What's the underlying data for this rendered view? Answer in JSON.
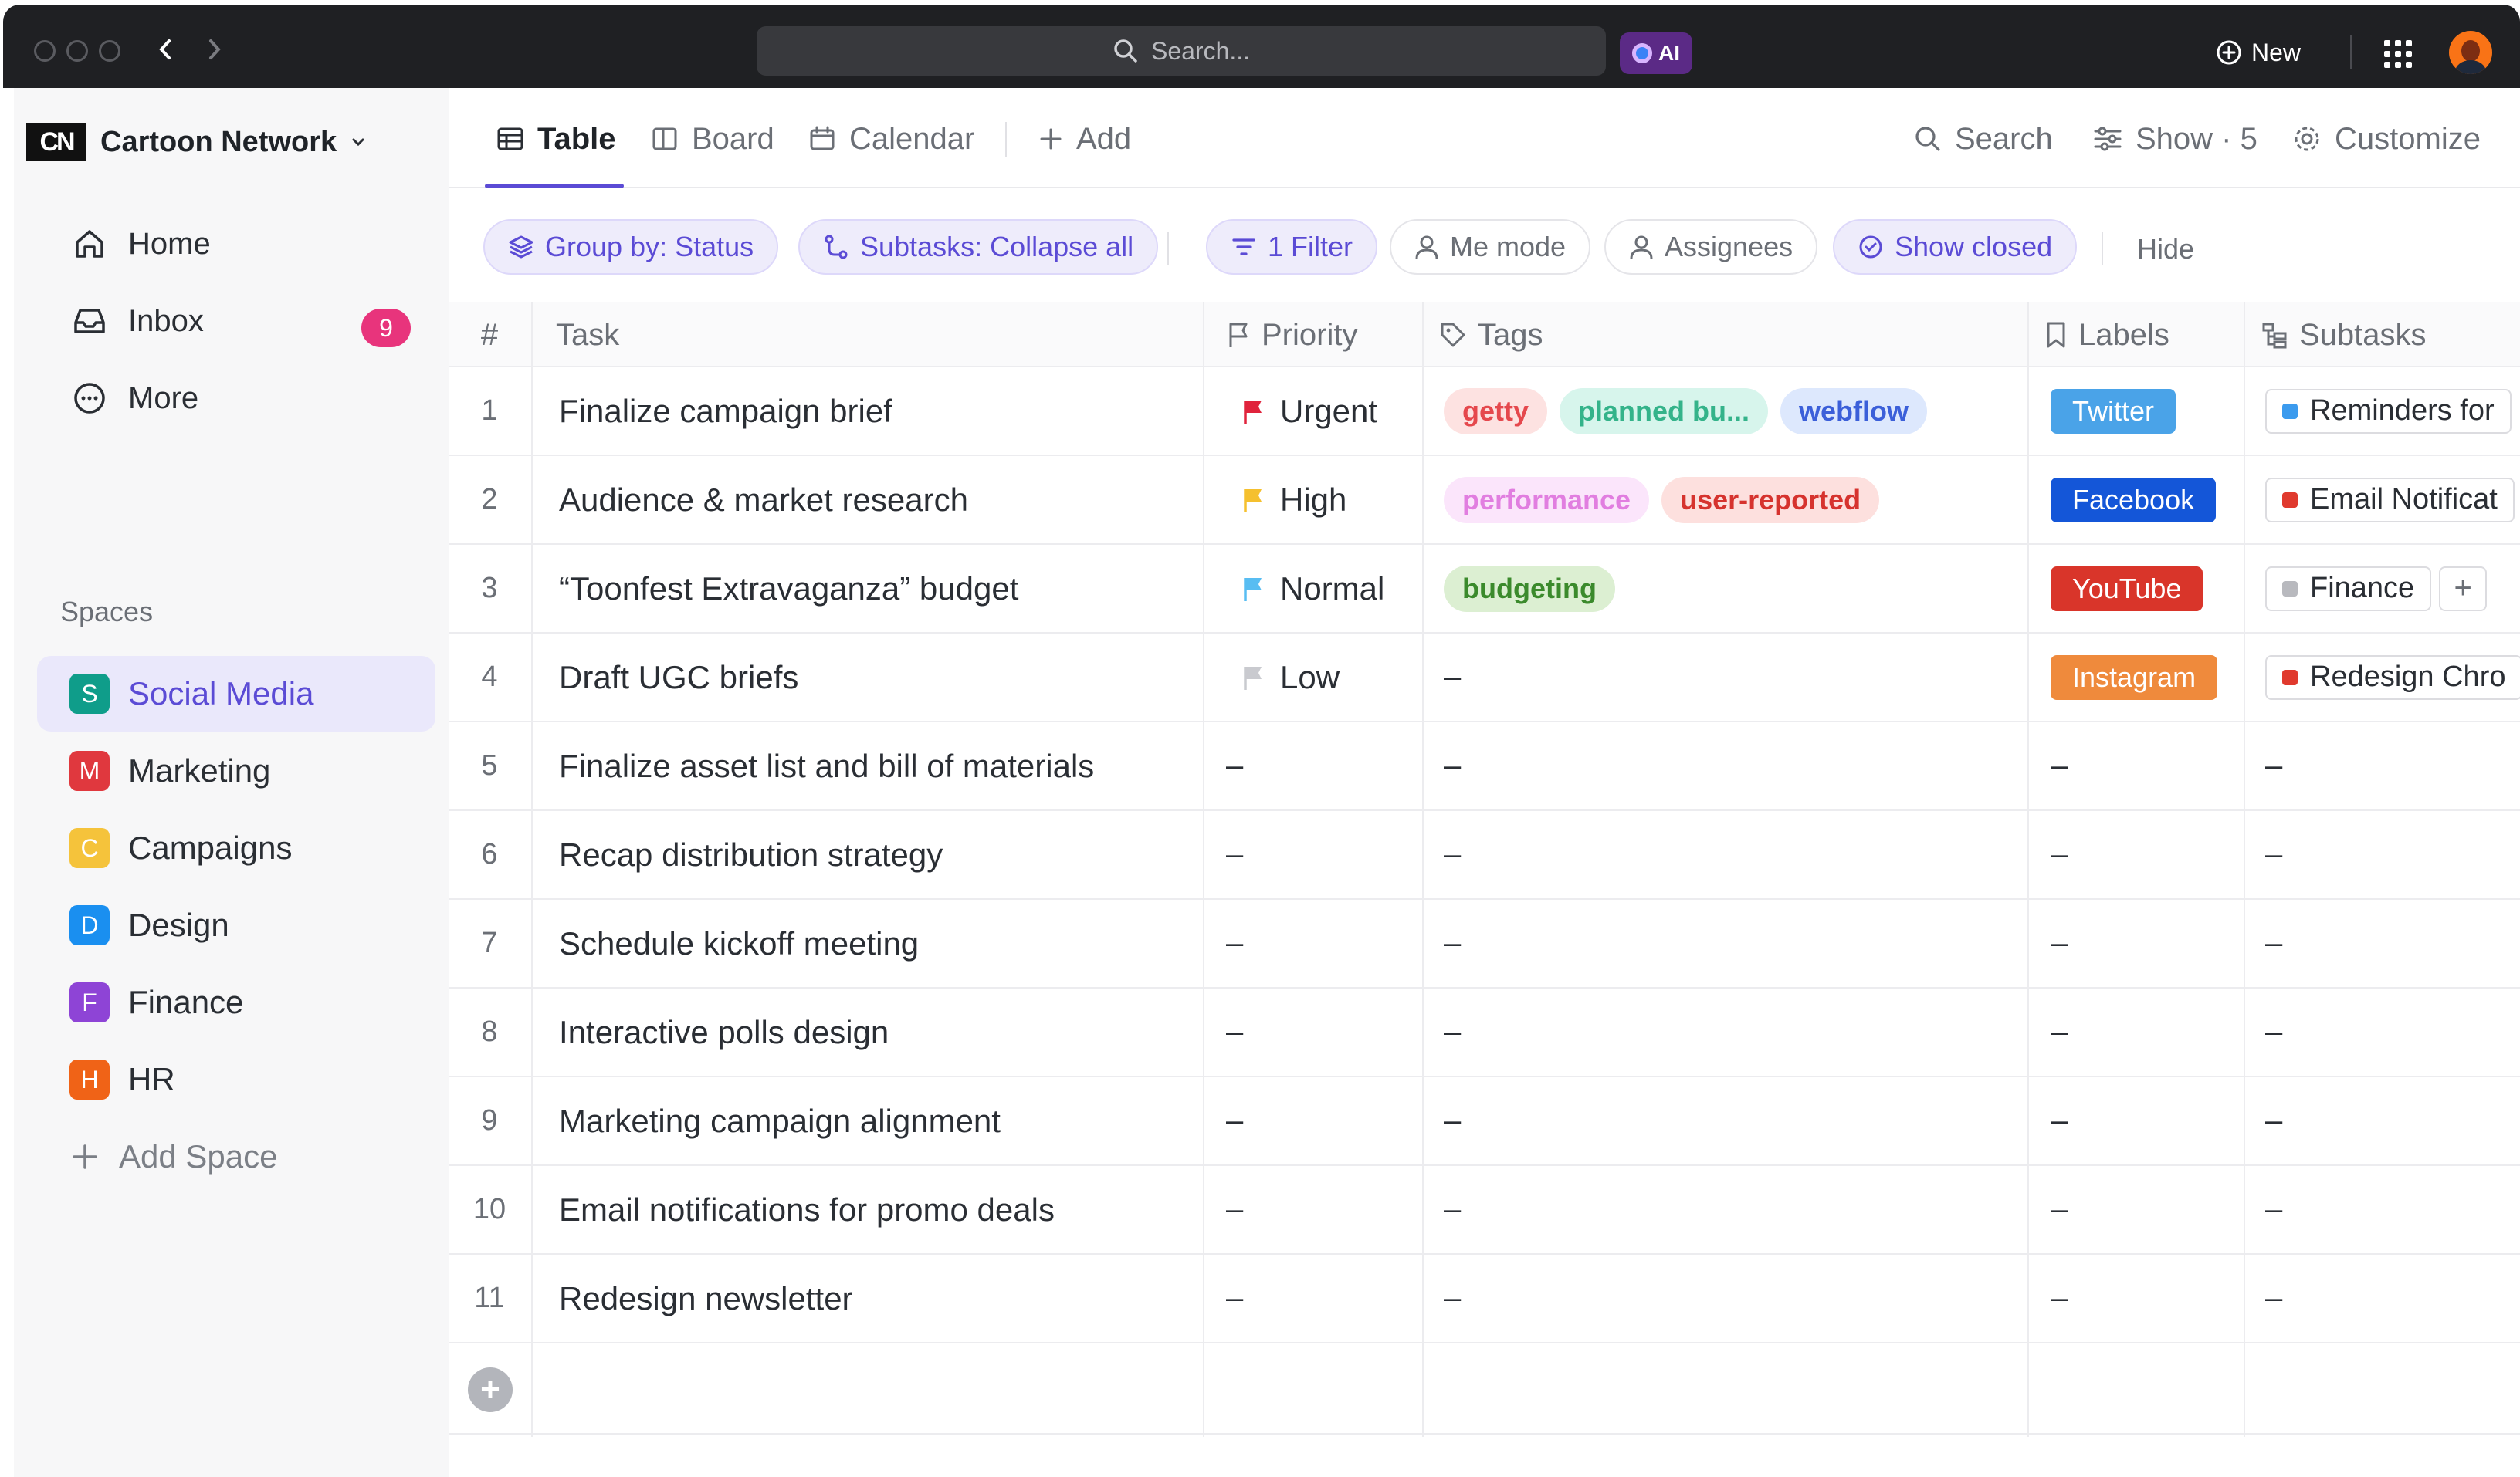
{
  "titlebar": {
    "search_placeholder": "Search...",
    "ai_label": "AI",
    "new_label": "New"
  },
  "sidebar": {
    "workspace_logo": "CN",
    "workspace_name": "Cartoon Network",
    "nav": [
      {
        "label": "Home",
        "icon": "home-icon"
      },
      {
        "label": "Inbox",
        "icon": "inbox-icon",
        "badge": "9"
      },
      {
        "label": "More",
        "icon": "more-icon"
      }
    ],
    "spaces_label": "Spaces",
    "spaces": [
      {
        "letter": "S",
        "label": "Social Media",
        "color": "#0f9d8a",
        "active": true
      },
      {
        "letter": "M",
        "label": "Marketing",
        "color": "#e0383e"
      },
      {
        "letter": "C",
        "label": "Campaigns",
        "color": "#f5c33b"
      },
      {
        "letter": "D",
        "label": "Design",
        "color": "#1a8ff0"
      },
      {
        "letter": "F",
        "label": "Finance",
        "color": "#8e44d6"
      },
      {
        "letter": "H",
        "label": "HR",
        "color": "#f06317"
      }
    ],
    "add_space_label": "Add Space"
  },
  "views": {
    "tabs": [
      {
        "label": "Table",
        "icon": "table-icon",
        "active": true
      },
      {
        "label": "Board",
        "icon": "board-icon"
      },
      {
        "label": "Calendar",
        "icon": "calendar-icon"
      }
    ],
    "add_label": "Add",
    "search_label": "Search",
    "show_label": "Show · 5",
    "customize_label": "Customize"
  },
  "filters": {
    "group_by": "Group by: Status",
    "subtasks": "Subtasks: Collapse all",
    "filter": "1 Filter",
    "me_mode": "Me mode",
    "assignees": "Assignees",
    "show_closed": "Show closed",
    "hide": "Hide"
  },
  "table": {
    "columns": [
      "#",
      "Task",
      "Priority",
      "Tags",
      "Labels",
      "Subtasks"
    ],
    "rows": [
      {
        "num": "1",
        "task": "Finalize campaign brief",
        "priority": "Urgent",
        "flag_color": "#e0233c",
        "tags": [
          {
            "text": "getty",
            "bg": "#fde2e1",
            "fg": "#e5484d"
          },
          {
            "text": "planned bu...",
            "bg": "#d7f5ec",
            "fg": "#34b38a"
          },
          {
            "text": "webflow",
            "bg": "#dde8fd",
            "fg": "#3b5fd9"
          }
        ],
        "label": {
          "text": "Twitter",
          "bg": "#4aa3e8"
        },
        "subtask": {
          "text": "Reminders for",
          "color": "#3b9bee"
        }
      },
      {
        "num": "2",
        "task": "Audience & market research",
        "priority": "High",
        "flag_color": "#f5c02e",
        "tags": [
          {
            "text": "performance",
            "bg": "#fbe5fb",
            "fg": "#e17ee0"
          },
          {
            "text": "user-reported",
            "bg": "#fde0de",
            "fg": "#d6332e"
          }
        ],
        "label": {
          "text": "Facebook",
          "bg": "#1456d8"
        },
        "subtask": {
          "text": "Email Notificat",
          "color": "#e03a2e"
        }
      },
      {
        "num": "3",
        "task": "“Toonfest Extravaganza” budget",
        "priority": "Normal",
        "flag_color": "#58bdf2",
        "tags": [
          {
            "text": "budgeting",
            "bg": "#dcefd2",
            "fg": "#3b8a2c"
          }
        ],
        "label": {
          "text": "YouTube",
          "bg": "#d9352a"
        },
        "subtask": {
          "text": "Finance",
          "color": "#b8b9be"
        },
        "subtask_plus": "+"
      },
      {
        "num": "4",
        "task": "Draft UGC briefs",
        "priority": "Low",
        "flag_color": "#c9cacf",
        "tags": [],
        "tags_empty": "–",
        "label": {
          "text": "Instagram",
          "bg": "#ef8a3c"
        },
        "subtask": {
          "text": "Redesign Chro",
          "color": "#e03a2e"
        }
      },
      {
        "num": "5",
        "task": "Finalize asset list and bill of materials",
        "empty": "–"
      },
      {
        "num": "6",
        "task": "Recap distribution strategy",
        "empty": "–"
      },
      {
        "num": "7",
        "task": "Schedule kickoff meeting",
        "empty": "–"
      },
      {
        "num": "8",
        "task": "Interactive polls design",
        "empty": "–"
      },
      {
        "num": "9",
        "task": "Marketing campaign alignment",
        "empty": "–"
      },
      {
        "num": "10",
        "task": "Email notifications for promo deals",
        "empty": "–"
      },
      {
        "num": "11",
        "task": "Redesign newsletter",
        "empty": "–"
      }
    ]
  },
  "colors": {
    "accent": "#5b4bd5",
    "titlebar": "#1f2023",
    "badge": "#e8347c"
  }
}
